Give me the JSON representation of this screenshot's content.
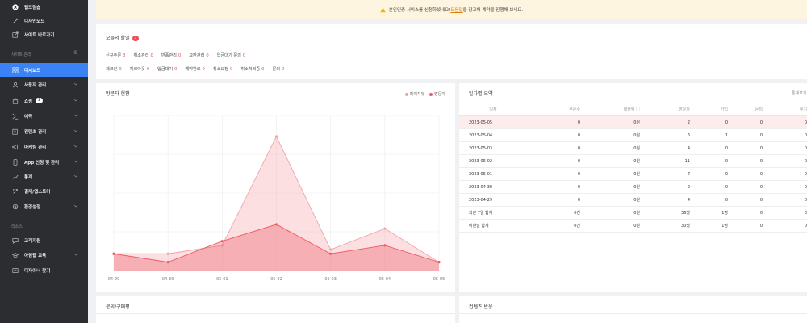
{
  "sidebar": {
    "top_items": [
      {
        "label": "웹드림숍",
        "icon": "x-circle-icon"
      },
      {
        "label": "디자인모드",
        "icon": "pen-icon"
      },
      {
        "label": "사이트 바로가기",
        "icon": "external-link-icon"
      }
    ],
    "section_site": "사이트 관리",
    "section_plus": "⊕",
    "items": [
      {
        "label": "대시보드",
        "icon": "grid-icon",
        "active": true
      },
      {
        "label": "사용자 관리",
        "icon": "user-icon"
      },
      {
        "label": "쇼핑",
        "icon": "bag-icon",
        "badge": "3"
      },
      {
        "label": "예약",
        "icon": "calendar-icon"
      },
      {
        "label": "컨텐츠 관리",
        "icon": "edit-icon"
      },
      {
        "label": "마케팅 관리",
        "icon": "megaphone-icon"
      },
      {
        "label": "App 신청 및 관리",
        "icon": "phone-icon"
      },
      {
        "label": "통계",
        "icon": "chart-icon"
      },
      {
        "label": "결제/앱스토어",
        "icon": "store-icon"
      },
      {
        "label": "환경설정",
        "icon": "gear-icon"
      }
    ],
    "section_other": "리소스",
    "other_items": [
      {
        "label": "고객지원",
        "icon": "chat-icon"
      },
      {
        "label": "아임웹 교육",
        "icon": "graduation-icon"
      },
      {
        "label": "디자이너 찾기",
        "icon": "search-person-icon"
      }
    ]
  },
  "notice": {
    "text_before": "본인인증 서비스를 신청하셨네요! ",
    "link": "도움말",
    "text_after": "을 참고해 계약을 진행해 보세요."
  },
  "todo": {
    "title": "오늘의 할일",
    "count": "3",
    "row1": [
      {
        "label": "신규주문",
        "value": "3"
      },
      {
        "label": "취소관리",
        "value": "0"
      },
      {
        "label": "반품관리",
        "value": "0"
      },
      {
        "label": "교환관리",
        "value": "0"
      },
      {
        "label": "입금대기 문의",
        "value": "0"
      }
    ],
    "row2": [
      {
        "label": "체크인",
        "value": "0"
      },
      {
        "label": "체크아웃",
        "value": "0"
      },
      {
        "label": "입금대기",
        "value": "0"
      },
      {
        "label": "예약완료",
        "value": "0"
      },
      {
        "label": "취소요청",
        "value": "0"
      },
      {
        "label": "취소처리중",
        "value": "0"
      },
      {
        "label": "문의",
        "value": "0"
      }
    ]
  },
  "visitor_panel": {
    "title": "방문자 현황",
    "legend": [
      "페이지뷰",
      "방문자"
    ]
  },
  "chart_data": {
    "type": "area",
    "categories": [
      "04-29",
      "04-30",
      "05-01",
      "05-02",
      "05-03",
      "05-04",
      "05-05"
    ],
    "series": [
      {
        "name": "페이지뷰",
        "values": [
          4,
          4,
          6,
          32,
          5,
          10,
          2
        ],
        "color": "#f4a3a8"
      },
      {
        "name": "방문자",
        "values": [
          4,
          2,
          7,
          11,
          4,
          6,
          2
        ],
        "color": "#ef5a64"
      }
    ],
    "ylim": [
      0,
      37
    ],
    "grid": true
  },
  "daily_panel": {
    "title": "일자별 요약",
    "more": "통계보기",
    "headers": [
      "일자",
      "주문수",
      "매출액 ⓘ",
      "방문자",
      "가입",
      "문의",
      "후기"
    ],
    "rows": [
      [
        "2023-05-05",
        "0",
        "0원",
        "2",
        "0",
        "0",
        "0"
      ],
      [
        "2023-05-04",
        "0",
        "0원",
        "6",
        "1",
        "0",
        "0"
      ],
      [
        "2023-05-03",
        "0",
        "0원",
        "4",
        "0",
        "0",
        "0"
      ],
      [
        "2023-05-02",
        "0",
        "0원",
        "11",
        "0",
        "0",
        "0"
      ],
      [
        "2023-05-01",
        "0",
        "0원",
        "7",
        "0",
        "0",
        "0"
      ],
      [
        "2023-04-30",
        "0",
        "0원",
        "2",
        "0",
        "0",
        "0"
      ],
      [
        "2023-04-29",
        "0",
        "0원",
        "4",
        "0",
        "0",
        "0"
      ],
      [
        "최근 7일 합계",
        "0건",
        "0원",
        "36명",
        "1명",
        "0",
        "0"
      ],
      [
        "이번달 합계",
        "0건",
        "0원",
        "30명",
        "1명",
        "0",
        "0"
      ]
    ]
  },
  "bottom_left": {
    "title": "문의/구매평"
  },
  "bottom_right": {
    "title": "컨텐츠 반응"
  },
  "colors": {
    "accent": "#3b82f6",
    "danger": "#ef4c5c",
    "sidebar": "#2b2d31",
    "notice_bg": "#fdf5e0"
  }
}
